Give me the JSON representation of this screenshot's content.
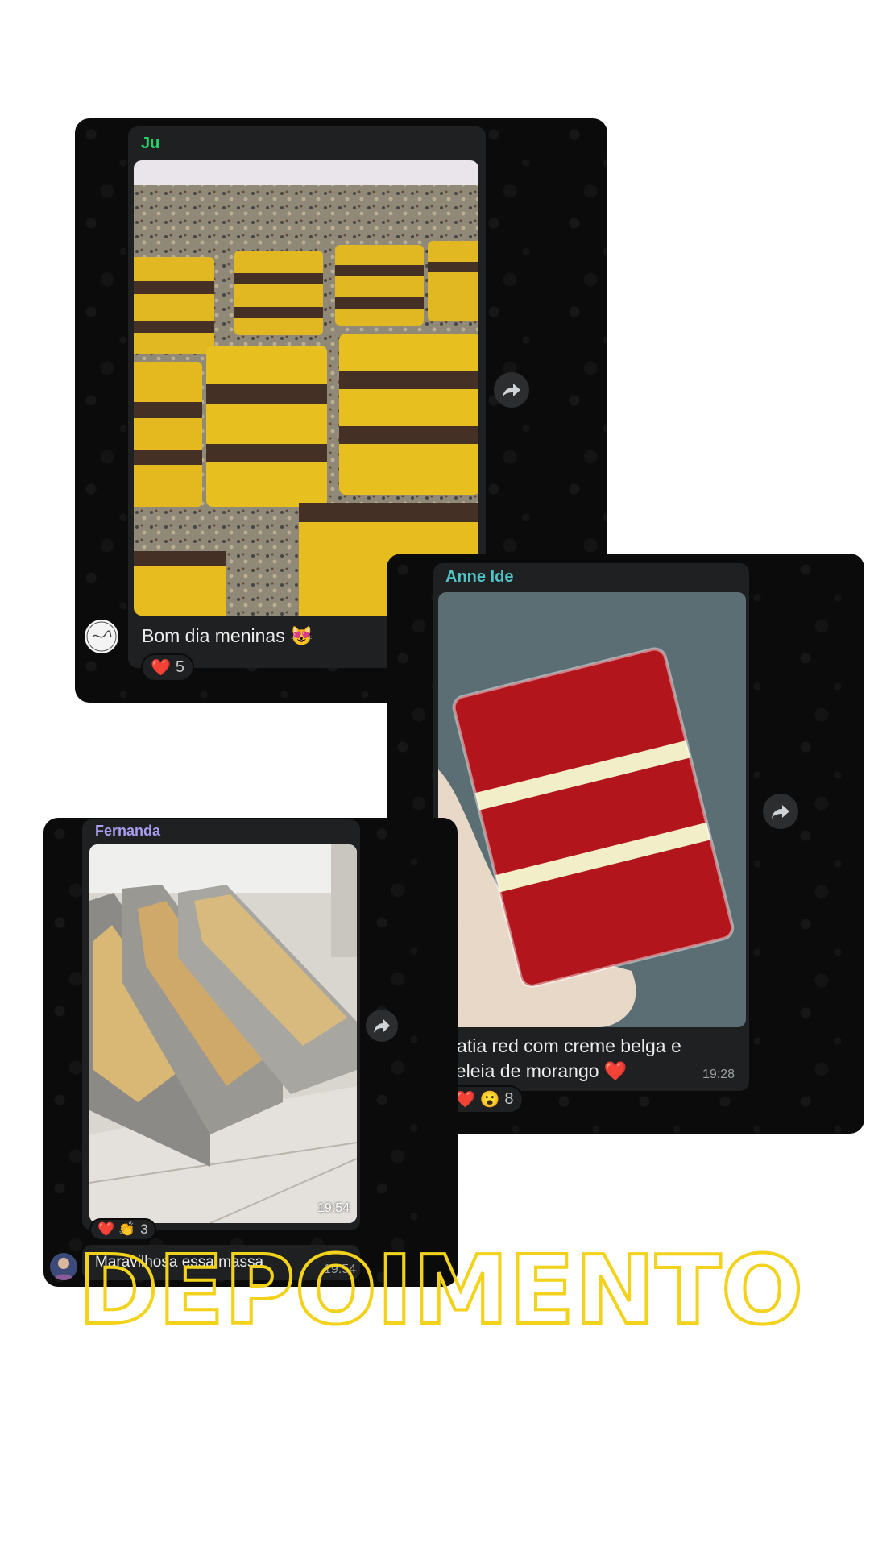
{
  "messages": [
    {
      "sender": "Ju",
      "sender_color": "#25d366",
      "caption": "Bom dia meninas 😻",
      "reactions": {
        "emojis": "❤️",
        "count": "5"
      }
    },
    {
      "sender": "Anne Ide",
      "sender_color": "#4fc3c6",
      "caption_line1": "Fatia red com creme belga e",
      "caption_line2": "geleia de morango ❤️",
      "time": "19:28",
      "reactions": {
        "emojis": "❤️ 😮",
        "count": "8"
      }
    },
    {
      "sender": "Fernanda",
      "sender_color": "#a79ef0",
      "time": "19:54",
      "reactions": {
        "emojis": "❤️ 👏",
        "count": "3"
      },
      "next_caption": "Maravilhosa essa massa",
      "next_time": "19:54"
    }
  ],
  "overlay_title": "DEPOIMENTO",
  "colors": {
    "chat_bg": "#0b0b0b",
    "bubble": "#1f2021",
    "title_outline": "#f2d21b"
  },
  "icons": [
    "forward-icon",
    "avatar"
  ]
}
